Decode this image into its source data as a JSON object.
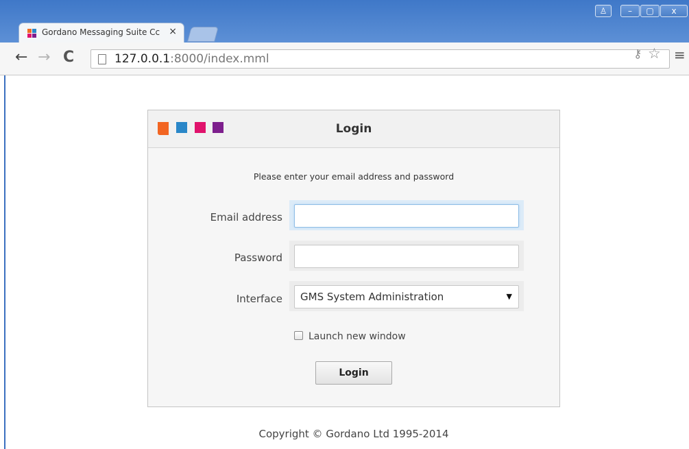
{
  "browser": {
    "tab_title": "Gordano Messaging Suite Cc",
    "tab_close": "×",
    "window_controls": {
      "user": "♙",
      "minimize": "–",
      "maximize": "▢",
      "close": "x"
    },
    "nav": {
      "back": "←",
      "forward": "→",
      "reload": "C"
    },
    "url_host": "127.0.0.1",
    "url_rest": ":8000/index.mml",
    "icons": {
      "key": "⚷",
      "star": "☆",
      "menu": "≡"
    }
  },
  "colors": {
    "logo": [
      "#f26522",
      "#2a87c8",
      "#e0136c",
      "#7d1f8d"
    ],
    "favicon": [
      "#ef6c22",
      "#2a87c8",
      "#e0136c",
      "#7d1f8d"
    ]
  },
  "login": {
    "title": "Login",
    "instructions": "Please enter your email address and password",
    "email_label": "Email address",
    "email_value": "",
    "password_label": "Password",
    "password_value": "",
    "interface_label": "Interface",
    "interface_selected": "GMS System Administration",
    "interface_arrow": "▼",
    "launch_label": "Launch new window",
    "launch_checked": false,
    "submit_label": "Login"
  },
  "footer": {
    "copyright": "Copyright © Gordano Ltd 1995-2014"
  }
}
